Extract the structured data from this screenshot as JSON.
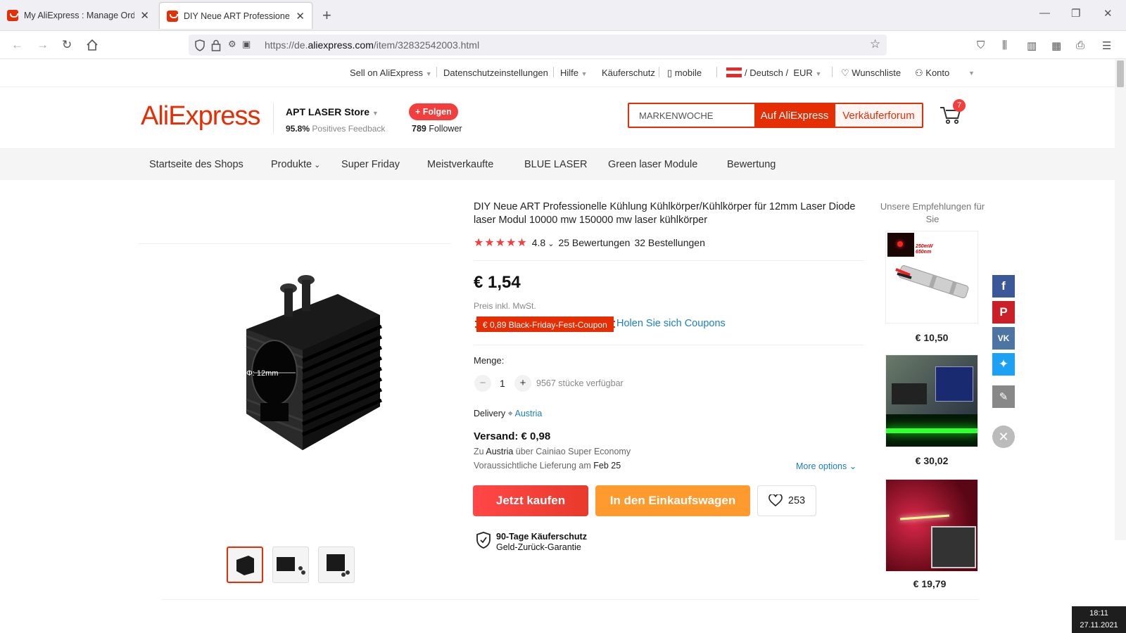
{
  "browser": {
    "tabs": [
      {
        "title": "My AliExpress : Manage Orders"
      },
      {
        "title": "DIY Neue ART Professionelle Kühlung"
      }
    ],
    "url_prefix": "https://de.",
    "url_domain": "aliexpress.com",
    "url_path": "/item/32832542003.html"
  },
  "util_bar": {
    "sell": "Sell on AliExpress",
    "privacy": "Datenschutzeinstellungen",
    "help": "Hilfe",
    "buyer_protection": "Käuferschutz",
    "mobile": "mobile",
    "locale": "/ Deutsch /",
    "currency": "EUR",
    "wishlist": "Wunschliste",
    "account": "Konto"
  },
  "header": {
    "logo": "AliExpress",
    "store_name": "APT LASER Store",
    "feedback_pct": "95.8%",
    "feedback_label": "Positives Feedback",
    "follow_label": "+ Folgen",
    "follower_count": "789",
    "follower_label": "Follower",
    "search_value": "MARKENWOCHE",
    "search_button": "Auf AliExpress",
    "seller_forum": "Verkäuferforum",
    "cart_count": "7"
  },
  "store_nav": [
    "Startseite des Shops",
    "Produkte",
    "Super Friday",
    "Meistverkaufte",
    "BLUE LASER",
    "Green laser Module",
    "Bewertung"
  ],
  "product": {
    "image_label": "Φ: 12mm",
    "title": "DIY Neue ART Professionelle Kühlung Kühlkörper/Kühlkörper für 12mm Laser Diode laser Modul 10000 mw 150000 mw laser kühlkörper",
    "rating": "4.8",
    "reviews": "25 Bewertungen",
    "orders": "32 Bestellungen",
    "price": "€ 1,54",
    "tax_note": "Preis inkl. MwSt.",
    "coupon": "€ 0,89 Black-Friday-Fest-Coupon",
    "get_coupons": "Holen Sie sich Coupons",
    "quantity_label": "Menge:",
    "quantity": "1",
    "available": "9567 stücke verfügbar",
    "delivery_label": "Delivery",
    "delivery_location": "Austria",
    "shipping": "Versand: € 0,98",
    "ship_line1_a": "Zu",
    "ship_line1_b": "Austria",
    "ship_line1_c": "über Cainiao Super Economy",
    "ship_line2_a": "Voraussichtliche Lieferung am",
    "ship_line2_b": "Feb 25",
    "more_options": "More options",
    "buy_now": "Jetzt kaufen",
    "add_to_cart": "In den Einkaufswagen",
    "wishlist_count": "253",
    "protection_title": "90-Tage Käuferschutz",
    "protection_sub": "Geld-Zurück-Garantie"
  },
  "recommendations": {
    "title": "Unsere Empfehlungen für Sie",
    "badge": "250mW 650nm",
    "prices": [
      "€ 10,50",
      "€ 30,02",
      "€ 19,79"
    ]
  },
  "taskbar": {
    "time": "18:11",
    "date": "27.11.2021"
  },
  "colors": {
    "accent": "#e62e04",
    "cart_orange": "#ff9a2e",
    "link": "#1b7fc4"
  }
}
